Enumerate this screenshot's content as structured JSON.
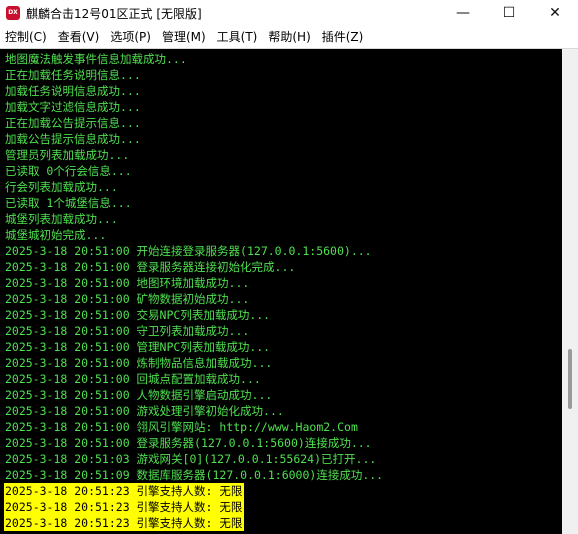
{
  "window": {
    "icon_text": "DX",
    "title": "麒麟合击12号01区正式 [无限版]",
    "minimize_glyph": "—",
    "maximize_glyph": "☐",
    "close_glyph": "✕"
  },
  "menu": [
    {
      "label": "控制(C)"
    },
    {
      "label": "查看(V)"
    },
    {
      "label": "选项(P)"
    },
    {
      "label": "管理(M)"
    },
    {
      "label": "工具(T)"
    },
    {
      "label": "帮助(H)"
    },
    {
      "label": "插件(Z)"
    }
  ],
  "console": {
    "lines": [
      "地图魔法触发事件信息加载成功...",
      "正在加载任务说明信息...",
      "加载任务说明信息成功...",
      "加载文字过滤信息成功...",
      "正在加载公告提示信息...",
      "加载公告提示信息成功...",
      "管理员列表加载成功...",
      "已读取 0个行会信息...",
      "行会列表加载成功...",
      "已读取 1个城堡信息...",
      "城堡列表加载成功...",
      "城堡城初始完成...",
      "2025-3-18 20:51:00 开始连接登录服务器(127.0.0.1:5600)...",
      "2025-3-18 20:51:00 登录服务器连接初始化完成...",
      "2025-3-18 20:51:00 地图环境加载成功...",
      "2025-3-18 20:51:00 矿物数据初始成功...",
      "2025-3-18 20:51:00 交易NPC列表加载成功...",
      "2025-3-18 20:51:00 守卫列表加载成功...",
      "2025-3-18 20:51:00 管理NPC列表加载成功...",
      "2025-3-18 20:51:00 炼制物品信息加载成功...",
      "2025-3-18 20:51:00 回城点配置加载成功...",
      "2025-3-18 20:51:00 人物数据引擎启动成功...",
      "2025-3-18 20:51:00 游戏处理引擎初始化成功...",
      "2025-3-18 20:51:00 翎风引擎网站: http://www.Haom2.Com",
      "2025-3-18 20:51:00 登录服务器(127.0.0.1:5600)连接成功...",
      "2025-3-18 20:51:03 游戏网关[0](127.0.0.1:55624)已打开...",
      "2025-3-18 20:51:09 数据库服务器(127.0.0.1:6000)连接成功..."
    ],
    "highlighted_lines": [
      "2025-3-18 20:51:23 引擎支持人数: 无限",
      "2025-3-18 20:51:23 引擎支持人数: 无限",
      "2025-3-18 20:51:23 引擎支持人数: 无限"
    ],
    "text_color": "#4fe04f",
    "highlight_color": "#ffff00"
  }
}
